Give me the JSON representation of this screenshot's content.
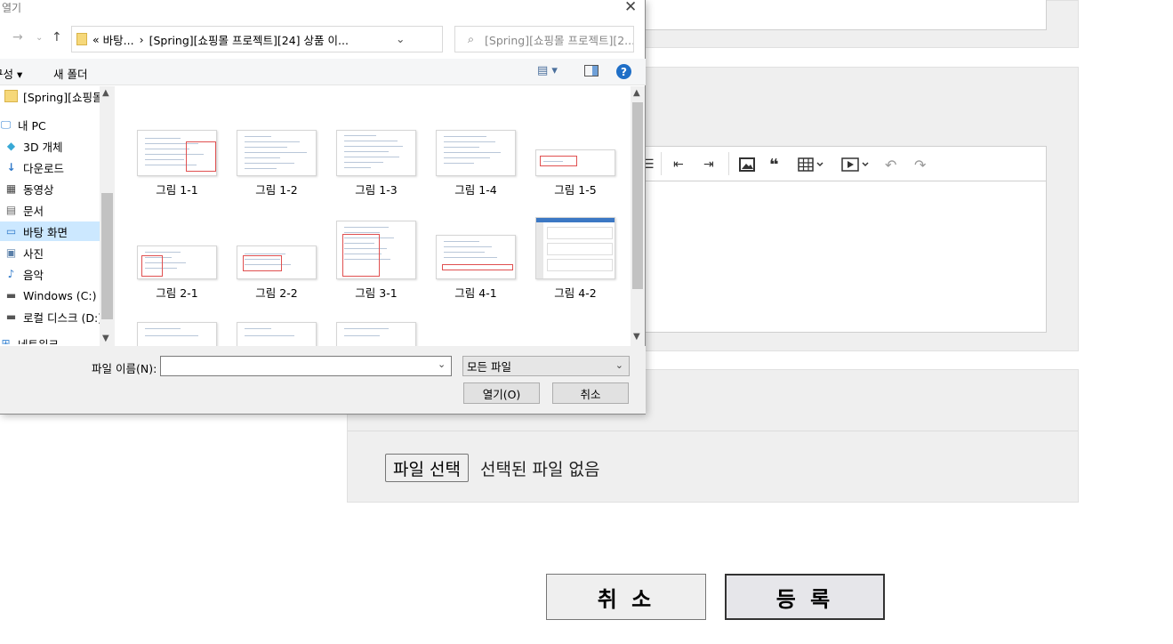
{
  "dialog": {
    "title": "열기",
    "address_segments": [
      "«",
      "바탕...",
      "›",
      "[Spring][쇼핑몰 프로젝트][24] 상품 이..."
    ],
    "search_placeholder": "[Spring][쇼핑몰 프로젝트][2...",
    "organize_label": "구성 ▾",
    "new_folder_label": "새 폴더",
    "help_label": "?",
    "nav_items": [
      {
        "label": "[Spring][쇼핑몰",
        "icon": "folder-icon"
      },
      {
        "label": "내 PC",
        "icon": "pc-icon"
      },
      {
        "label": "3D 개체",
        "icon": "cube-icon"
      },
      {
        "label": "다운로드",
        "icon": "download-icon"
      },
      {
        "label": "동영상",
        "icon": "video-icon"
      },
      {
        "label": "문서",
        "icon": "document-icon"
      },
      {
        "label": "바탕 화면",
        "icon": "desktop-icon",
        "selected": true
      },
      {
        "label": "사진",
        "icon": "picture-icon"
      },
      {
        "label": "음악",
        "icon": "music-icon"
      },
      {
        "label": "Windows (C:)",
        "icon": "drive-icon"
      },
      {
        "label": "로컬 디스크 (D:)",
        "icon": "drive-icon"
      },
      {
        "label": "네트워크",
        "icon": "network-icon"
      }
    ],
    "files": [
      "그림 1-1",
      "그림 1-2",
      "그림 1-3",
      "그림 1-4",
      "그림 1-5",
      "그림 2-1",
      "그림 2-2",
      "그림 3-1",
      "그림 4-1",
      "그림 4-2"
    ],
    "filename_label": "파일 이름(N):",
    "filename_value": "",
    "filetype_value": "모든 파일",
    "open_label": "열기(O)",
    "cancel_label": "취소"
  },
  "page": {
    "file_button_label": "파일 선택",
    "file_status": "선택된 파일 없음",
    "cancel_label": "취 소",
    "submit_label": "등 록"
  }
}
